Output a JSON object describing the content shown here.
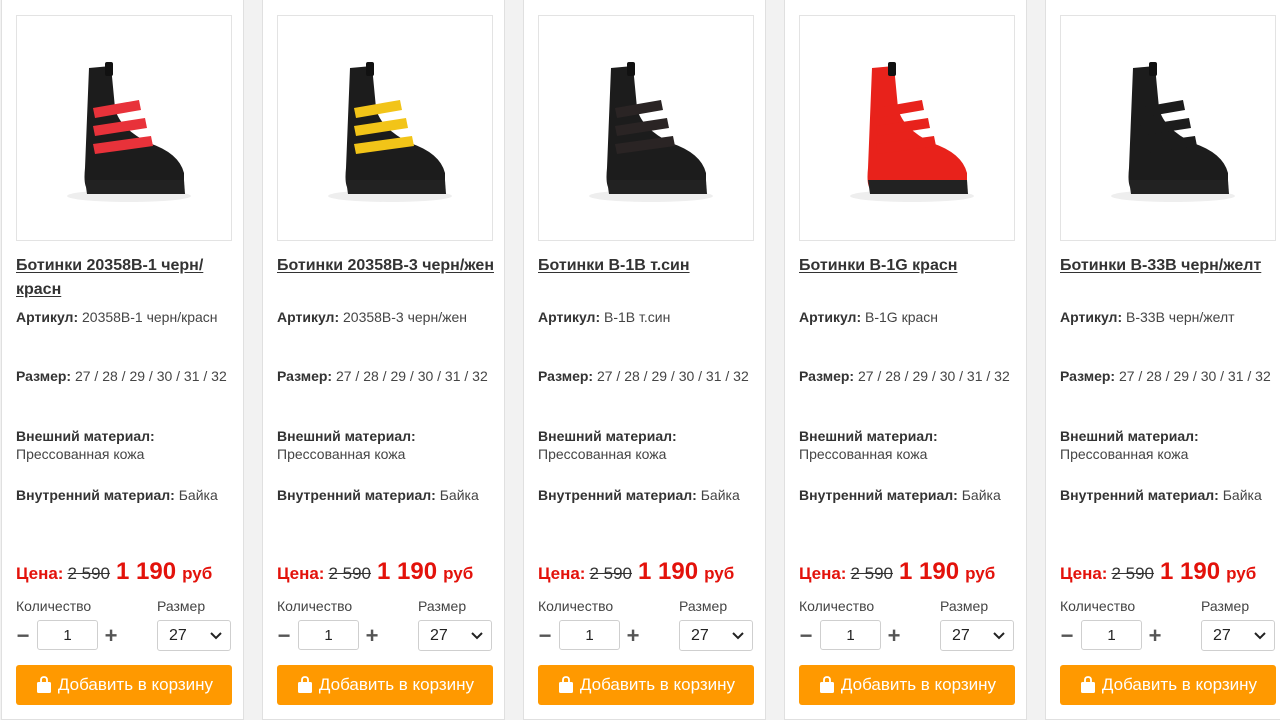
{
  "products": [
    {
      "title": "Ботинки 20358В-1 черн/красн",
      "article_label": "Артикул:",
      "article": "20358В-1 черн/красн",
      "size_label": "Размер:",
      "sizes": "27 / 28 / 29 / 30 / 31 / 32",
      "outer_label": "Внешний материал:",
      "outer": "Прессованная кожа",
      "inner_label": "Внутренний материал:",
      "inner": "Байка",
      "price_label": "Цена:",
      "old_price": "2 590",
      "new_price": "1 190",
      "currency": "руб",
      "qty_label": "Количество",
      "qty": "1",
      "size_select_label": "Размер",
      "size_selected": "27",
      "button": "Добавить в корзину",
      "accent": "#e8323a"
    },
    {
      "title": "Ботинки 20358В-3 черн/жен",
      "article_label": "Артикул:",
      "article": "20358В-3 черн/жен",
      "size_label": "Размер:",
      "sizes": "27 / 28 / 29 / 30 / 31 / 32",
      "outer_label": "Внешний материал:",
      "outer": "Прессованная кожа",
      "inner_label": "Внутренний материал:",
      "inner": "Байка",
      "price_label": "Цена:",
      "old_price": "2 590",
      "new_price": "1 190",
      "currency": "руб",
      "qty_label": "Количество",
      "qty": "1",
      "size_select_label": "Размер",
      "size_selected": "27",
      "button": "Добавить в корзину",
      "accent": "#f2c418"
    },
    {
      "title": "Ботинки В-1В т.син",
      "article_label": "Артикул:",
      "article": "В-1В т.син",
      "size_label": "Размер:",
      "sizes": "27 / 28 / 29 / 30 / 31 / 32",
      "outer_label": "Внешний материал:",
      "outer": "Прессованная кожа",
      "inner_label": "Внутренний материал:",
      "inner": "Байка",
      "price_label": "Цена:",
      "old_price": "2 590",
      "new_price": "1 190",
      "currency": "руб",
      "qty_label": "Количество",
      "qty": "1",
      "size_select_label": "Размер",
      "size_selected": "27",
      "button": "Добавить в корзину",
      "accent": "#2a2424"
    },
    {
      "title": "Ботинки В-1G красн",
      "article_label": "Артикул:",
      "article": "В-1G красн",
      "size_label": "Размер:",
      "sizes": "27 / 28 / 29 / 30 / 31 / 32",
      "outer_label": "Внешний материал:",
      "outer": "Прессованная кожа",
      "inner_label": "Внутренний материал:",
      "inner": "Байка",
      "price_label": "Цена:",
      "old_price": "2 590",
      "new_price": "1 190",
      "currency": "руб",
      "qty_label": "Количество",
      "qty": "1",
      "size_select_label": "Размер",
      "size_selected": "27",
      "button": "Добавить в корзину",
      "accent": "#e8221b"
    },
    {
      "title": "Ботинки В-33В черн/желт",
      "article_label": "Артикул:",
      "article": "В-33В черн/желт",
      "size_label": "Размер:",
      "sizes": "27 / 28 / 29 / 30 / 31 / 32",
      "outer_label": "Внешний материал:",
      "outer": "Прессованная кожа",
      "inner_label": "Внутренний материал:",
      "inner": "Байка",
      "price_label": "Цена:",
      "old_price": "2 590",
      "new_price": "1 190",
      "currency": "руб",
      "qty_label": "Количество",
      "qty": "1",
      "size_select_label": "Размер",
      "size_selected": "27",
      "button": "Добавить в корзину",
      "accent": "#1c1c1c"
    }
  ],
  "icons": {
    "minus": "minus-icon",
    "plus": "plus-icon",
    "chevron": "chevron-down-icon",
    "bag": "shopping-bag-icon"
  },
  "colors": {
    "button_bg": "#ff9900",
    "price_red": "#e3120b"
  }
}
